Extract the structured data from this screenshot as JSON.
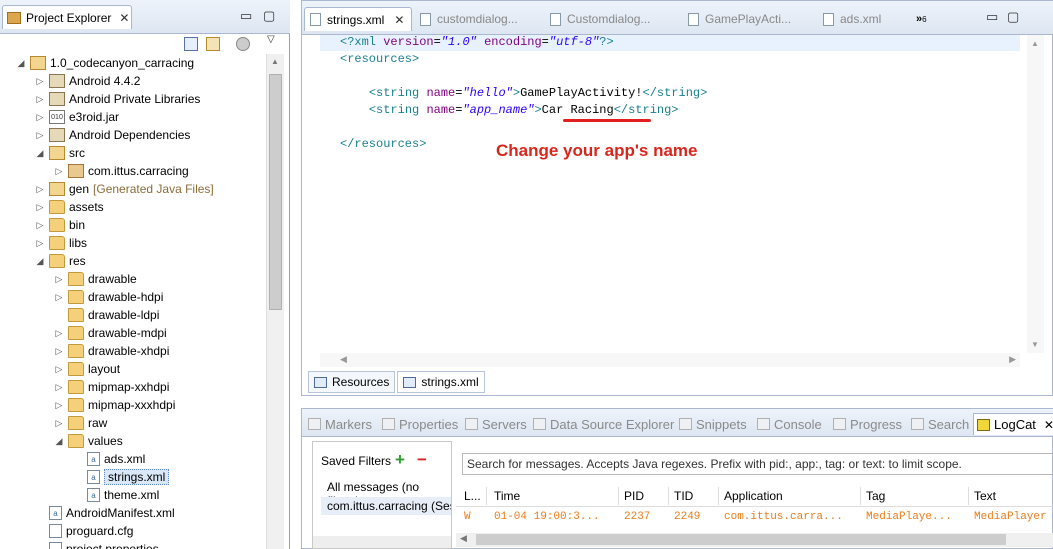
{
  "project_explorer": {
    "title": "Project Explorer",
    "tree": [
      {
        "label": "1.0_codecanyon_carracing",
        "indent": 0,
        "twisty": "▲",
        "icon": "project-icon"
      },
      {
        "label": "Android 4.4.2",
        "indent": 1,
        "twisty": "▷",
        "icon": "library-icon"
      },
      {
        "label": "Android Private Libraries",
        "indent": 1,
        "twisty": "▷",
        "icon": "library-icon"
      },
      {
        "label": "e3roid.jar",
        "indent": 1,
        "twisty": "▷",
        "icon": "jar-icon"
      },
      {
        "label": "Android Dependencies",
        "indent": 1,
        "twisty": "▷",
        "icon": "library-icon"
      },
      {
        "label": "src",
        "indent": 1,
        "twisty": "▲",
        "icon": "source-folder-icon"
      },
      {
        "label": "com.ittus.carracing",
        "indent": 2,
        "twisty": "▷",
        "icon": "package-icon"
      },
      {
        "label": "gen",
        "extra": "[Generated Java Files]",
        "indent": 1,
        "twisty": "▷",
        "icon": "source-folder-icon"
      },
      {
        "label": "assets",
        "indent": 1,
        "twisty": "▷",
        "icon": "folder-icon"
      },
      {
        "label": "bin",
        "indent": 1,
        "twisty": "▷",
        "icon": "folder-icon"
      },
      {
        "label": "libs",
        "indent": 1,
        "twisty": "▷",
        "icon": "folder-icon"
      },
      {
        "label": "res",
        "indent": 1,
        "twisty": "▲",
        "icon": "folder-icon"
      },
      {
        "label": "drawable",
        "indent": 2,
        "twisty": "▷",
        "icon": "folder-icon"
      },
      {
        "label": "drawable-hdpi",
        "indent": 2,
        "twisty": "▷",
        "icon": "folder-icon"
      },
      {
        "label": "drawable-ldpi",
        "indent": 2,
        "twisty": "",
        "icon": "folder-icon"
      },
      {
        "label": "drawable-mdpi",
        "indent": 2,
        "twisty": "▷",
        "icon": "folder-icon"
      },
      {
        "label": "drawable-xhdpi",
        "indent": 2,
        "twisty": "▷",
        "icon": "folder-icon"
      },
      {
        "label": "layout",
        "indent": 2,
        "twisty": "▷",
        "icon": "folder-icon"
      },
      {
        "label": "mipmap-xxhdpi",
        "indent": 2,
        "twisty": "▷",
        "icon": "folder-icon"
      },
      {
        "label": "mipmap-xxxhdpi",
        "indent": 2,
        "twisty": "▷",
        "icon": "folder-icon"
      },
      {
        "label": "raw",
        "indent": 2,
        "twisty": "▷",
        "icon": "folder-icon"
      },
      {
        "label": "values",
        "indent": 2,
        "twisty": "▲",
        "icon": "folder-icon"
      },
      {
        "label": "ads.xml",
        "indent": 3,
        "twisty": "",
        "icon": "xml-file-icon"
      },
      {
        "label": "strings.xml",
        "indent": 3,
        "twisty": "",
        "icon": "xml-file-icon",
        "selected": true
      },
      {
        "label": "theme.xml",
        "indent": 3,
        "twisty": "",
        "icon": "xml-file-icon"
      },
      {
        "label": "AndroidManifest.xml",
        "indent": 1,
        "twisty": "",
        "icon": "xml-file-icon"
      },
      {
        "label": "proguard.cfg",
        "indent": 1,
        "twisty": "",
        "icon": "config-file-icon"
      },
      {
        "label": "project.properties",
        "indent": 1,
        "twisty": "",
        "icon": "config-file-icon"
      }
    ]
  },
  "editor": {
    "tabs": [
      {
        "label": "strings.xml",
        "active": true
      },
      {
        "label": "customdialog...",
        "active": false
      },
      {
        "label": "Customdialog...",
        "active": false
      },
      {
        "label": "GamePlayActi...",
        "active": false
      },
      {
        "label": "ads.xml",
        "active": false
      }
    ],
    "overflow_count": "6",
    "code": {
      "decl_open": "<?",
      "decl_name": "xml",
      "version_attr": "version",
      "version_val": "\"1.0\"",
      "encoding_attr": "encoding",
      "encoding_val": "\"utf-8\"",
      "decl_close": "?>",
      "resources_open": "<resources>",
      "string_open": "<string",
      "name_attr": "name",
      "hello_key": "\"hello\"",
      "hello_text": "GamePlayActivity!",
      "app_name_key": "\"app_name\"",
      "app_name_text": "Car Racing",
      "string_close": "</string>",
      "resources_close": "</resources>"
    },
    "annotation": "Change your app's name",
    "bottom_tabs": [
      {
        "label": "Resources"
      },
      {
        "label": "strings.xml"
      }
    ]
  },
  "bottom_panel": {
    "tabs": [
      {
        "label": "Markers",
        "icon": "markers-icon"
      },
      {
        "label": "Properties",
        "icon": "properties-icon"
      },
      {
        "label": "Servers",
        "icon": "servers-icon"
      },
      {
        "label": "Data Source Explorer",
        "icon": "data-source-icon"
      },
      {
        "label": "Snippets",
        "icon": "snippets-icon"
      },
      {
        "label": "Console",
        "icon": "console-icon"
      },
      {
        "label": "Progress",
        "icon": "progress-icon"
      },
      {
        "label": "Search",
        "icon": "search-icon"
      },
      {
        "label": "LogCat",
        "icon": "logcat-icon",
        "active": true
      }
    ],
    "saved_filters": {
      "title": "Saved Filters",
      "items": [
        "All messages (no filters)",
        "com.ittus.carracing (Ses"
      ]
    },
    "search_placeholder": "Search for messages. Accepts Java regexes. Prefix with pid:, app:, tag: or text: to limit scope.",
    "log_columns": [
      "L...",
      "Time",
      "PID",
      "TID",
      "Application",
      "Tag",
      "Text"
    ],
    "log_rows": [
      {
        "level": "W",
        "time": "01-04 19:00:3...",
        "pid": "2237",
        "tid": "2249",
        "app": "com.ittus.carra...",
        "tag": "MediaPlaye...",
        "text": "MediaPlayer"
      }
    ],
    "warning_color": "#e87d1a"
  }
}
